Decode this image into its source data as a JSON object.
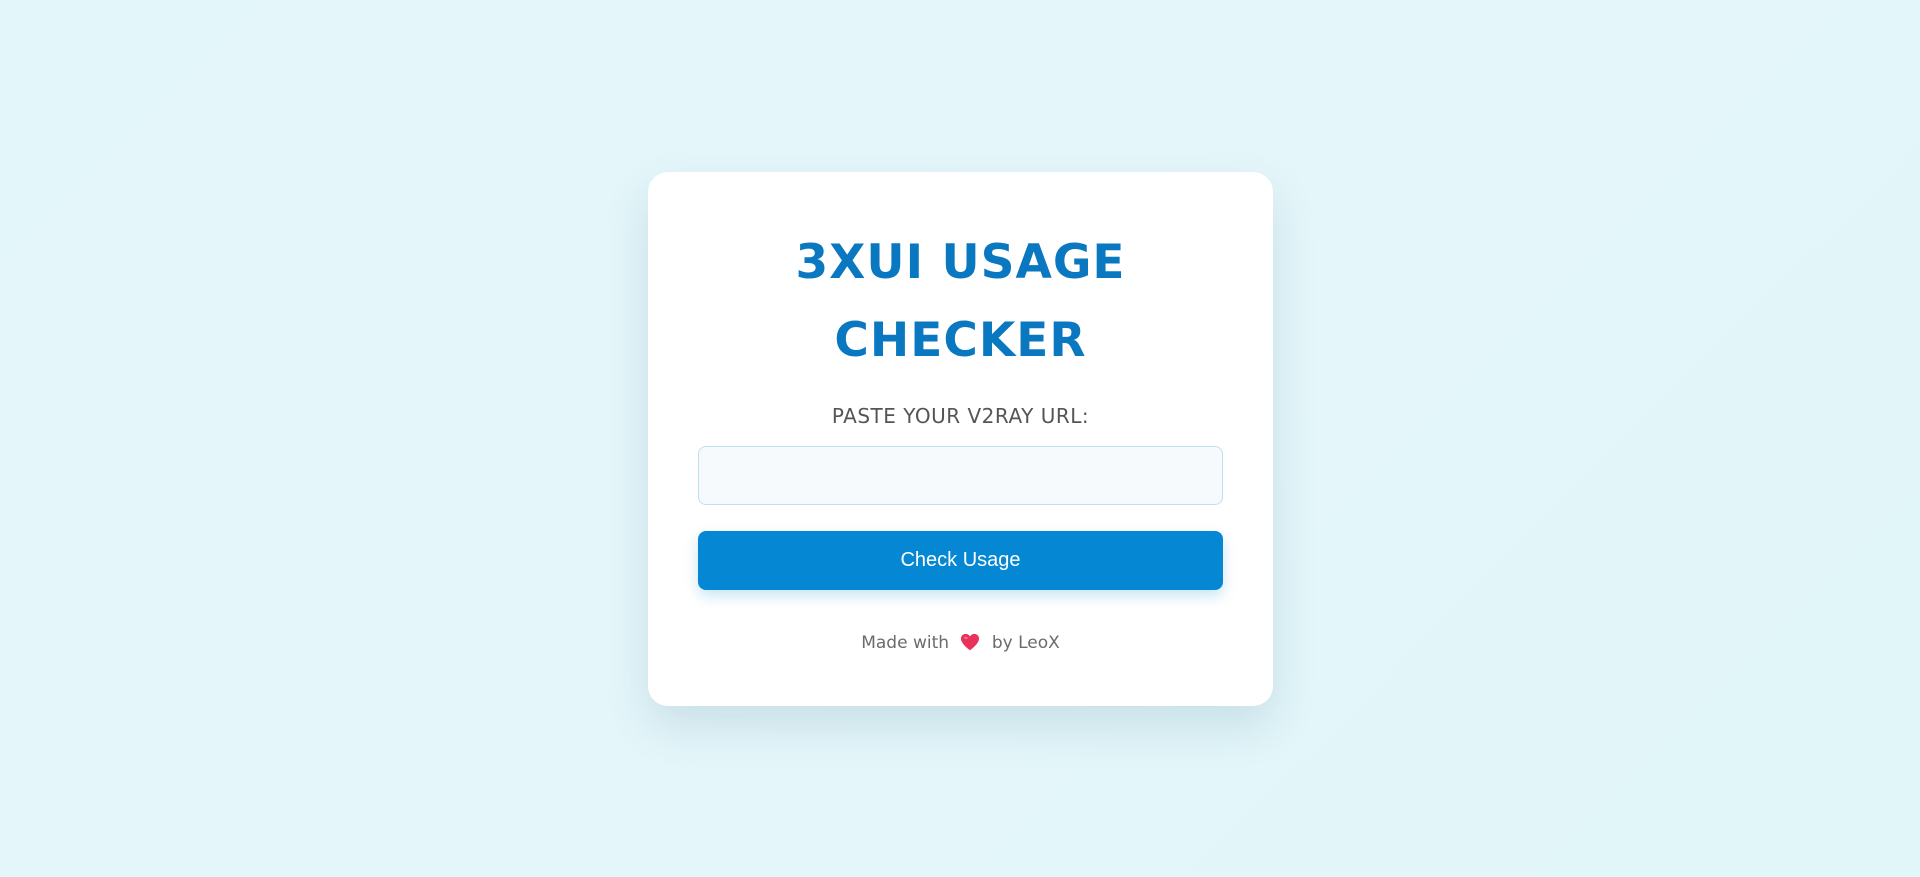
{
  "card": {
    "title_line1": "3XUI USAGE",
    "title_line2": "CHECKER",
    "label": "PASTE YOUR V2RAY URL:",
    "url_input": {
      "value": "",
      "placeholder": ""
    },
    "check_button_label": "Check Usage",
    "footer": {
      "made_with": "Made with",
      "icon": "heart-icon",
      "by": "by LeoX"
    }
  },
  "colors": {
    "accent": "#0a78c0",
    "button": "#0587d3",
    "heart": "#e8325a",
    "background": "#e3f6fa"
  }
}
